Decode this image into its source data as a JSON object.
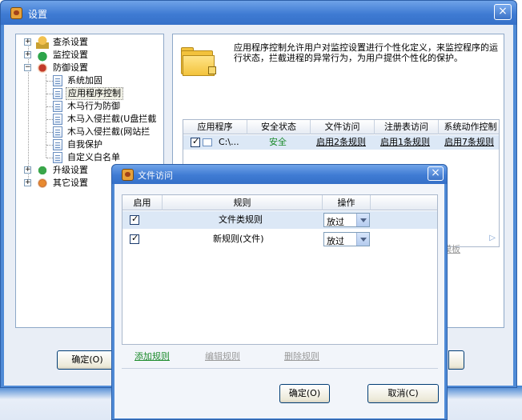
{
  "window": {
    "title": "设置",
    "close_label": "×"
  },
  "tree": {
    "items": [
      {
        "label": "查杀设置",
        "expander": "+",
        "icon": "lock-icon"
      },
      {
        "label": "监控设置",
        "expander": "+",
        "icon": "umbrella-icon"
      },
      {
        "label": "防御设置",
        "expander": "−",
        "icon": "shield-icon"
      },
      {
        "label": "系统加固"
      },
      {
        "label": "应用程序控制"
      },
      {
        "label": "木马行为防御"
      },
      {
        "label": "木马入侵拦截(U盘拦截"
      },
      {
        "label": "木马入侵拦截(网站拦"
      },
      {
        "label": "自我保护"
      },
      {
        "label": "自定义白名单"
      },
      {
        "label": "升级设置",
        "expander": "+",
        "icon": "update-icon"
      },
      {
        "label": "其它设置",
        "expander": "+",
        "icon": "gear-icon"
      }
    ]
  },
  "panel": {
    "description": "应用程序控制允许用户对监控设置进行个性化定义，来监控程序的运行状态，拦截进程的异常行为，为用户提供个性化的保护。",
    "columns": [
      "应用程序",
      "安全状态",
      "文件访问",
      "注册表访问",
      "系统动作控制"
    ],
    "rows": [
      {
        "app": "C:\\...",
        "status": "安全",
        "file": "启用2条规则",
        "reg": "启用1条规则",
        "sys": "启用7条规则"
      }
    ],
    "faded_link": "模板"
  },
  "main_buttons": {
    "ok": "确定(O)"
  },
  "dialog": {
    "title": "文件访问",
    "close_label": "×",
    "columns": [
      "启用",
      "规则",
      "操作"
    ],
    "rows": [
      {
        "rule": "文件类规则",
        "action": "放过"
      },
      {
        "rule": "新规则(文件)",
        "action": "放过"
      }
    ],
    "links": {
      "add": "添加规则",
      "edit": "编辑规则",
      "delete": "删除规则"
    },
    "buttons": {
      "ok": "确定(O)",
      "cancel": "取消(C)"
    }
  },
  "colors": {
    "title_bar": "#3f7bd3",
    "accent_green": "#1a8a2a",
    "selection": "#dce8f6"
  }
}
